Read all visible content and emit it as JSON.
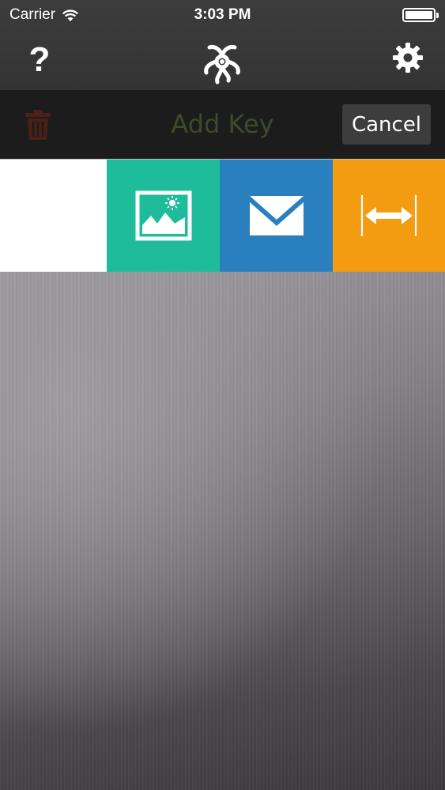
{
  "status_bar": {
    "carrier": "Carrier",
    "time": "3:03 PM"
  },
  "nav": {
    "help_label": "?",
    "logo_icon": "app-logo-icon",
    "settings_icon": "gear-icon"
  },
  "toolbar": {
    "title": "Add Key",
    "cancel_label": "Cancel",
    "trash_icon": "trash-icon"
  },
  "tiles": [
    {
      "name": "blank",
      "color": "#ffffff"
    },
    {
      "name": "photo",
      "icon": "image-icon",
      "color": "#1fbc9c"
    },
    {
      "name": "mail",
      "icon": "envelope-icon",
      "color": "#2a80be"
    },
    {
      "name": "resize",
      "icon": "horizontal-resize-icon",
      "color": "#f39c12"
    }
  ],
  "colors": {
    "header": "#3a3a3a",
    "toolbar": "#1c1c1c",
    "title_disabled": "#3e4a2c",
    "trash_disabled": "#4a2018"
  }
}
